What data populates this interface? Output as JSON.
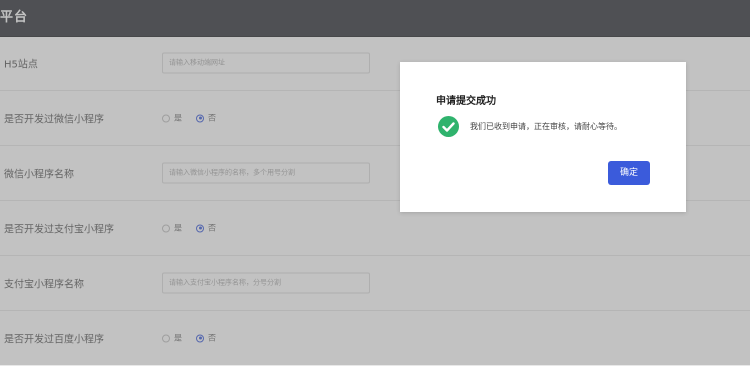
{
  "header": {
    "title": "平台"
  },
  "form": {
    "rows": [
      {
        "label": "H5站点",
        "type": "input",
        "placeholder": "请输入移动端网址"
      },
      {
        "label": "是否开发过微信小程序",
        "type": "radio",
        "options": [
          "是",
          "否"
        ],
        "selected": 1
      },
      {
        "label": "微信小程序名称",
        "type": "input",
        "placeholder": "请输入微信小程序的名称，多个用号分割"
      },
      {
        "label": "是否开发过支付宝小程序",
        "type": "radio",
        "options": [
          "是",
          "否"
        ],
        "selected": 1
      },
      {
        "label": "支付宝小程序名称",
        "type": "input",
        "placeholder": "请输入支付宝小程序名称，分号分割"
      },
      {
        "label": "是否开发过百度小程序",
        "type": "radio",
        "options": [
          "是",
          "否"
        ],
        "selected": 1
      }
    ]
  },
  "dialog": {
    "title": "申请提交成功",
    "message": "我们已收到申请，正在审核，请耐心等待。",
    "ok_label": "确定",
    "icon": "check-circle-icon",
    "accent_color": "#3b5bdb",
    "success_color": "#2fb36d"
  }
}
